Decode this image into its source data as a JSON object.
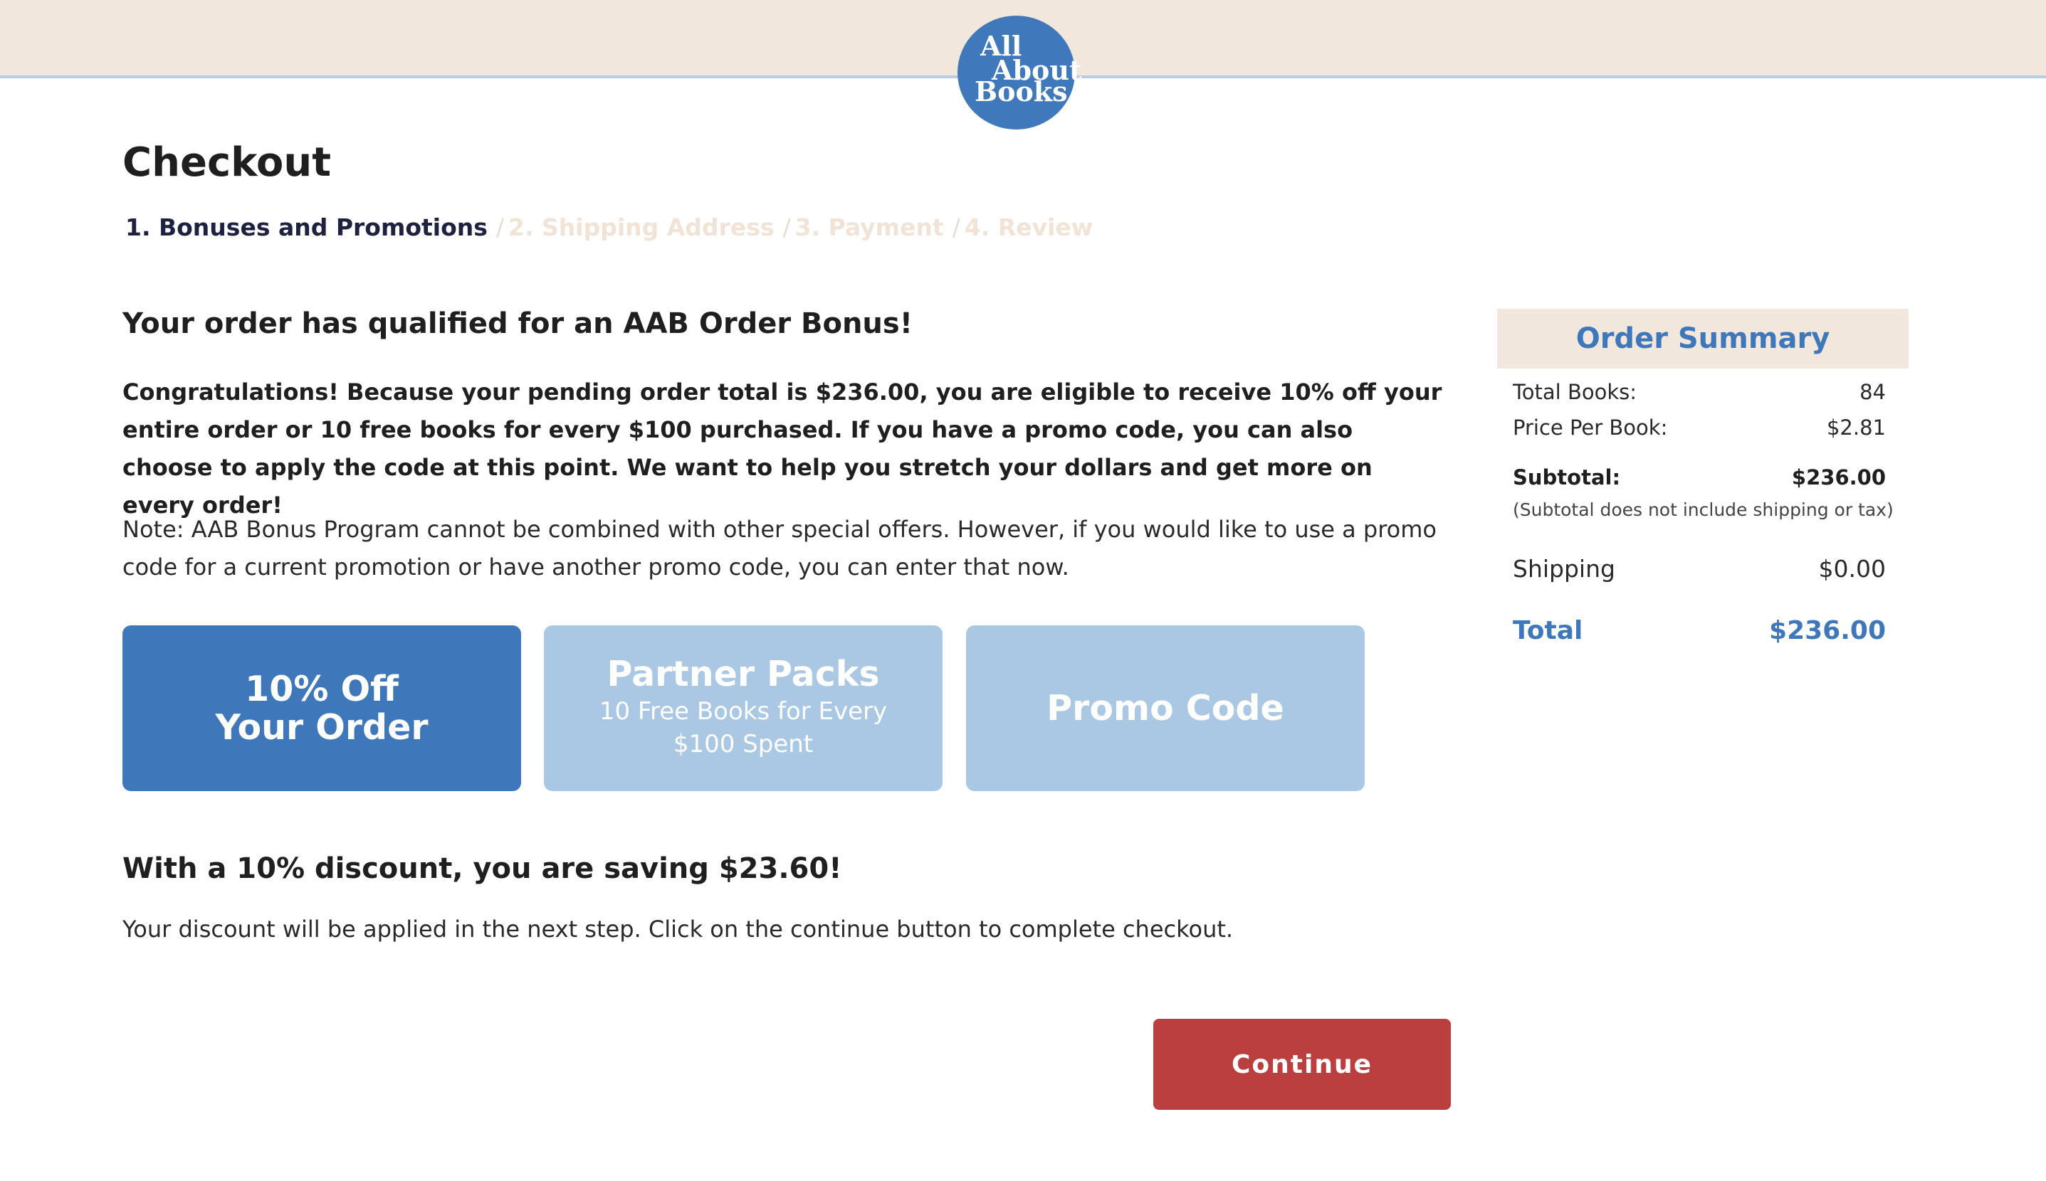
{
  "brand": {
    "logo_line1": "All",
    "logo_line2": "About",
    "logo_line3": "Books",
    "logo_color": "#3e77ba"
  },
  "page": {
    "title": "Checkout"
  },
  "steps": [
    {
      "label": "1. Bonuses and Promotions",
      "active": true
    },
    {
      "label": "2. Shipping Address",
      "active": false
    },
    {
      "label": "3. Payment",
      "active": false
    },
    {
      "label": "4. Review",
      "active": false
    }
  ],
  "step_separator": "/",
  "bonus": {
    "heading": "Your order has qualified for an AAB Order Bonus!",
    "congrats": "Congratulations! Because your pending order total is $236.00, you are eligible to receive 10% off your entire order or 10 free books for every $100 purchased. If you have a promo code, you can also choose to apply the code at this point. We want to help you stretch your dollars and get more on every order!",
    "note": "Note: AAB Bonus Program cannot be combined with other special offers. However, if you would like to use a promo code for a current promotion or have another promo code, you can enter that now."
  },
  "options": [
    {
      "title": "10% Off Your Order",
      "subtitle": "",
      "selected": true
    },
    {
      "title": "Partner Packs",
      "subtitle": "10 Free Books for Every $100 Spent",
      "selected": false
    },
    {
      "title": "Promo Code",
      "subtitle": "",
      "selected": false
    }
  ],
  "result": {
    "saving": "With a 10% discount, you are saving $23.60!",
    "applied_note": "Your discount will be applied in the next step. Click on the continue button to complete checkout."
  },
  "actions": {
    "continue_label": "Continue"
  },
  "summary": {
    "title": "Order Summary",
    "total_books_label": "Total Books:",
    "total_books_value": "84",
    "price_per_book_label": "Price Per Book:",
    "price_per_book_value": "$2.81",
    "subtotal_label": "Subtotal:",
    "subtotal_value": "$236.00",
    "subtotal_note": "(Subtotal does not include shipping or tax)",
    "shipping_label": "Shipping",
    "shipping_value": "$0.00",
    "total_label": "Total",
    "total_value": "$236.00"
  },
  "colors": {
    "header_bg": "#f1e7dd",
    "primary_blue": "#3e77ba",
    "light_blue": "#aac8e4",
    "continue_red": "#bc3f3f"
  }
}
